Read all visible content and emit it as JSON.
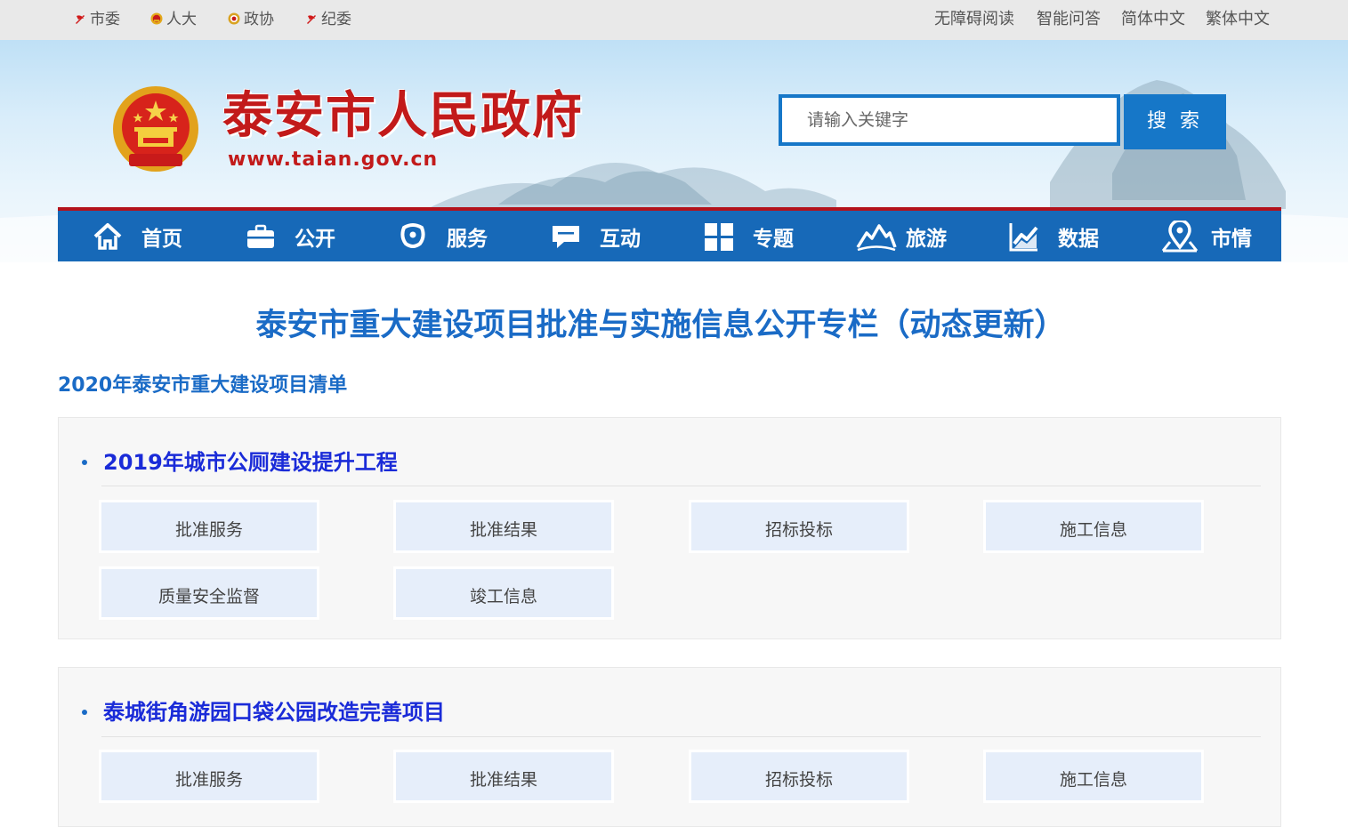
{
  "top_links": [
    {
      "label": "市委"
    },
    {
      "label": "人大"
    },
    {
      "label": "政协"
    },
    {
      "label": "纪委"
    }
  ],
  "right_links": [
    {
      "label": "无障碍阅读"
    },
    {
      "label": "智能问答"
    },
    {
      "label": "简体中文"
    },
    {
      "label": "繁体中文"
    }
  ],
  "header": {
    "site_title": "泰安市人民政府",
    "site_url": "www.taian.gov.cn",
    "search_placeholder": "请输入关键字",
    "search_button": "搜 索"
  },
  "nav": [
    {
      "label": "首页",
      "icon": "home-icon"
    },
    {
      "label": "公开",
      "icon": "briefcase-icon"
    },
    {
      "label": "服务",
      "icon": "service-icon"
    },
    {
      "label": "互动",
      "icon": "chat-icon"
    },
    {
      "label": "专题",
      "icon": "grid-icon"
    },
    {
      "label": "旅游",
      "icon": "mountain-icon"
    },
    {
      "label": "数据",
      "icon": "chart-icon"
    },
    {
      "label": "市情",
      "icon": "map-pin-icon"
    }
  ],
  "main": {
    "page_title": "泰安市重大建设项目批准与实施信息公开专栏（动态更新）",
    "list_title": "2020年泰安市重大建设项目清单",
    "projects": [
      {
        "title": "2019年城市公厕建设提升工程",
        "links": [
          "批准服务",
          "批准结果",
          "招标投标",
          "施工信息",
          "质量安全监督",
          "竣工信息"
        ]
      },
      {
        "title": "泰城街角游园口袋公园改造完善项目",
        "links": [
          "批准服务",
          "批准结果",
          "招标投标",
          "施工信息"
        ]
      }
    ]
  },
  "colors": {
    "brand_red": "#c21a1a",
    "nav_blue": "#1769b8",
    "title_blue": "#1a6bc6",
    "project_blue": "#1a2bd8"
  }
}
